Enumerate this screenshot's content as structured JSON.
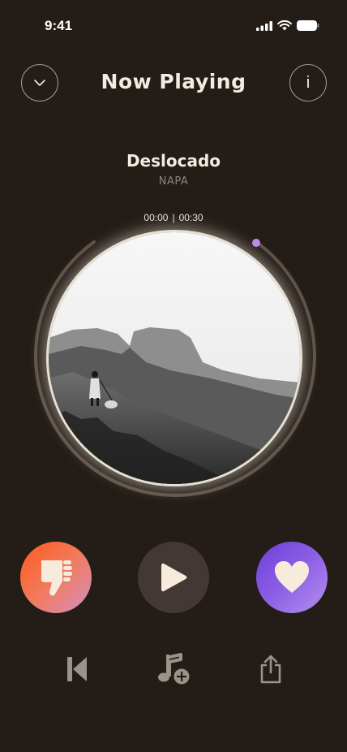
{
  "status_bar": {
    "time": "9:41"
  },
  "header": {
    "title": "Now Playing"
  },
  "track": {
    "title": "Deslocado",
    "artist": "NAPA"
  },
  "playback": {
    "elapsed": "00:00",
    "separator": "|",
    "duration": "00:30",
    "progress_fraction": 0
  },
  "colors": {
    "background": "#231c17",
    "dislike_gradient": [
      "#ff5a1e",
      "#d48fc1"
    ],
    "like_gradient": [
      "#6b3fd6",
      "#b590ef"
    ],
    "play_button": "#433833",
    "progress_dot": "#b98be8",
    "icon_cream": "#f7ecdb"
  },
  "icons": {
    "collapse": "chevron-down-icon",
    "info": "info-icon",
    "dislike": "thumbs-down-icon",
    "play": "play-icon",
    "like": "heart-icon",
    "previous": "skip-back-icon",
    "add_music": "music-note-plus-icon",
    "share": "share-icon"
  },
  "info_label": "i"
}
